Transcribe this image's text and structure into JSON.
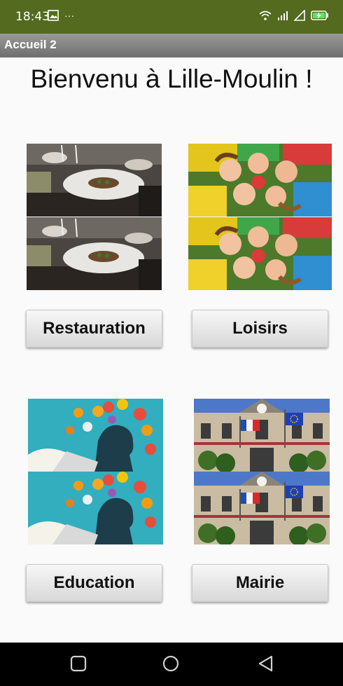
{
  "status_bar": {
    "time": "18:43",
    "more": "···",
    "icons": [
      "image-icon",
      "wifi-icon",
      "signal-icon",
      "signal-triangle-icon",
      "battery-charging-icon"
    ],
    "color": "#536a1f"
  },
  "title_bar": {
    "title": "Accueil 2"
  },
  "main": {
    "welcome": "Bienvenu à Lille-Moulin !",
    "sections": [
      {
        "id": "restauration",
        "image_icon": "restaurant-photo",
        "button_label": "Restauration"
      },
      {
        "id": "loisirs",
        "image_icon": "children-playing-photo",
        "button_label": "Loisirs"
      },
      {
        "id": "education",
        "image_icon": "education-illustration",
        "button_label": "Education"
      },
      {
        "id": "mairie",
        "image_icon": "town-hall-photo",
        "button_label": "Mairie"
      }
    ]
  },
  "nav_bar": {
    "icons": [
      "recent-apps-icon",
      "home-icon",
      "back-icon"
    ]
  }
}
